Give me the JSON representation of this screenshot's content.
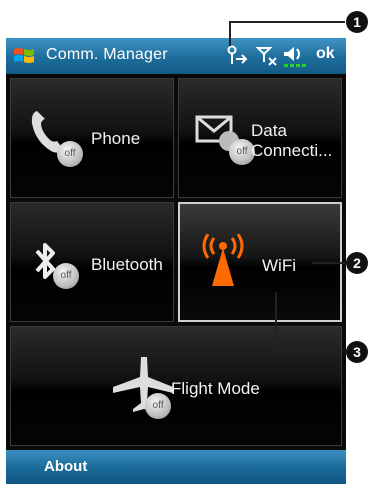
{
  "titlebar": {
    "title": "Comm. Manager",
    "ok_label": "ok",
    "status_icons": [
      "connection-sync-icon",
      "no-signal-icon",
      "volume-icon"
    ]
  },
  "tiles": [
    {
      "label": "Phone",
      "icon": "phone-icon",
      "badge": "off"
    },
    {
      "label": "Data Connecti...",
      "label_line1": "Data",
      "label_line2": "Connecti...",
      "icon": "mail-globe-icon",
      "badge": "off"
    },
    {
      "label": "Bluetooth",
      "icon": "bluetooth-icon",
      "badge": "off"
    },
    {
      "label": "WiFi",
      "icon": "wifi-antenna-icon",
      "state": "on"
    },
    {
      "label": "Flight Mode",
      "icon": "airplane-icon",
      "badge": "off"
    }
  ],
  "menubar": {
    "about_label": "About"
  },
  "callouts": [
    "1",
    "2",
    "3"
  ],
  "colors": {
    "titlebar": "#1e6d9c",
    "wifi_active": "#ff6a00",
    "signal_green": "#2bd12b"
  }
}
